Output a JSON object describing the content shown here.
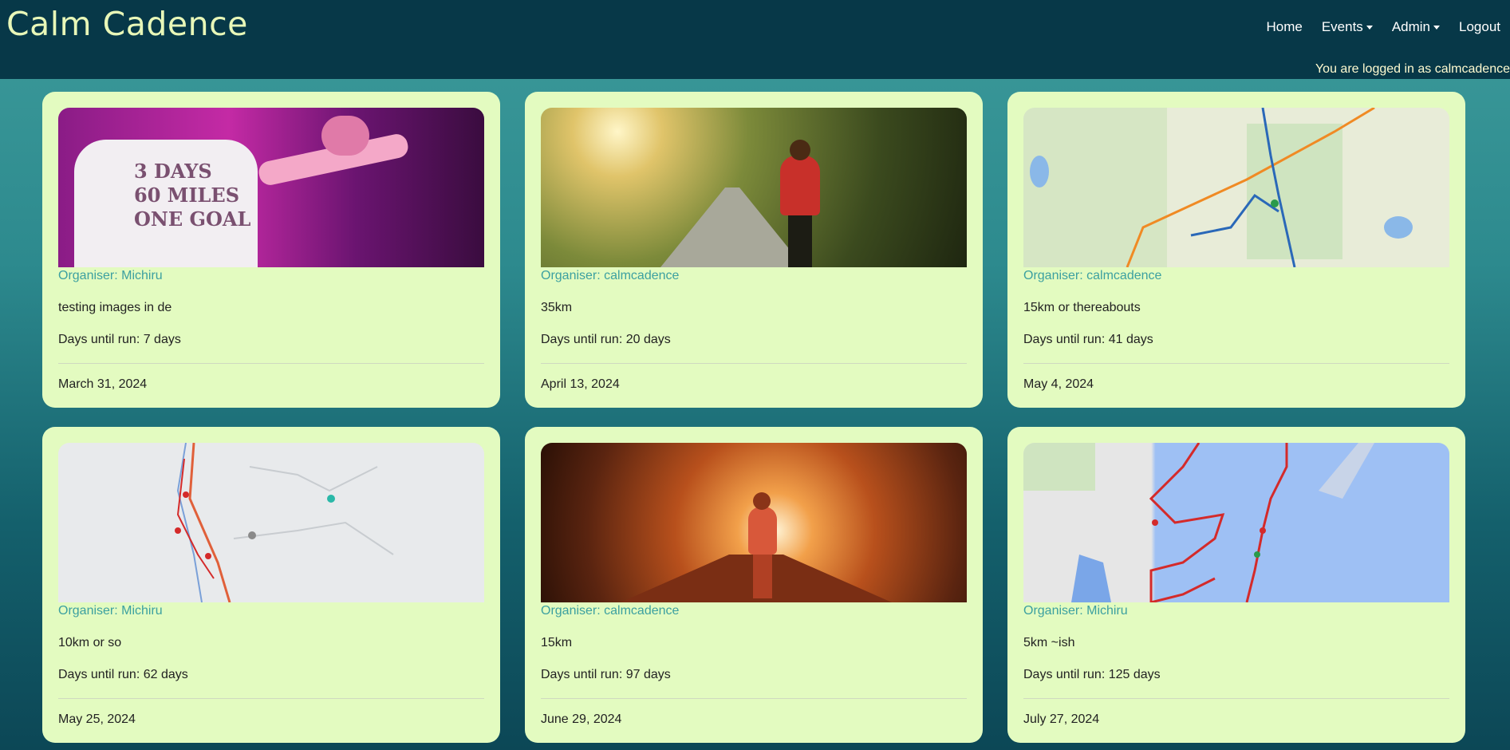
{
  "app": {
    "title": "Calm Cadence"
  },
  "nav": {
    "home": "Home",
    "events": "Events",
    "admin": "Admin",
    "logout": "Logout"
  },
  "user": {
    "status": "You are logged in as calmcadence"
  },
  "colors": {
    "navbar": "#073848",
    "card": "#e3fbc0",
    "organiser": "#3ca0a0",
    "brand": "#e8f7b8"
  },
  "events": [
    {
      "organiser": "Organiser: Michiru",
      "description": "testing images in de",
      "days": "Days until run: 7 days",
      "date": "March 31, 2024",
      "image": "runners-pink-shirt-photo"
    },
    {
      "organiser": "Organiser: calmcadence",
      "description": "35km",
      "days": "Days until run: 20 days",
      "date": "April 13, 2024",
      "image": "country-road-walker-photo"
    },
    {
      "organiser": "Organiser: calmcadence",
      "description": "15km or thereabouts",
      "days": "Days until run: 41 days",
      "date": "May 4, 2024",
      "image": "route-map"
    },
    {
      "organiser": "Organiser: Michiru",
      "description": "10km or so",
      "days": "Days until run: 62 days",
      "date": "May 25, 2024",
      "image": "route-map"
    },
    {
      "organiser": "Organiser: calmcadence",
      "description": "15km",
      "days": "Days until run: 97 days",
      "date": "June 29, 2024",
      "image": "autumn-forest-runner-photo"
    },
    {
      "organiser": "Organiser: Michiru",
      "description": "5km ~ish",
      "days": "Days until run: 125 days",
      "date": "July 27, 2024",
      "image": "coastal-route-map"
    }
  ]
}
